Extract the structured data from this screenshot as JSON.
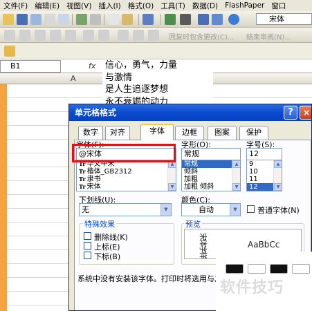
{
  "menubar": {
    "items": [
      "文件(F)",
      "编辑(E)",
      "视图(V)",
      "插入(I)",
      "格式(O)",
      "工具(T)",
      "数据(D)",
      "FlashPaper",
      "窗口"
    ]
  },
  "toolbar": {
    "font_name": "宋体",
    "review_reply": "回复时包含更改(C)...",
    "end_review": "结束审阅(N)..."
  },
  "formula_bar": {
    "name_box": "B1",
    "fx_label": "fx"
  },
  "sheet": {
    "column_a": "A",
    "cell_lines": [
      "信心，勇气，力量",
      "与激情",
      "是人生追逐梦想",
      "永不衰竭的动力"
    ]
  },
  "dialog": {
    "title": "单元格格式",
    "help": "?",
    "close": "×",
    "tabs": [
      "数字",
      "对齐",
      "字体",
      "边框",
      "图案",
      "保护"
    ],
    "active_tab": "字体",
    "font": {
      "label": "字体(F):",
      "value": "@宋体",
      "list": [
        "华文中宋",
        "楷体_GB2312",
        "隶书",
        "宋体"
      ]
    },
    "style": {
      "label": "字形(O):",
      "value": "常规",
      "list": [
        "常规",
        "倾斜",
        "加粗",
        "加粗 倾斜"
      ],
      "selected": "常规"
    },
    "size": {
      "label": "字号(S):",
      "value": "12",
      "list": [
        "9",
        "10",
        "11",
        "12"
      ],
      "selected": "12"
    },
    "underline": {
      "label": "下划线(U):",
      "value": "无"
    },
    "color": {
      "label": "颜色(C):",
      "value": "自动"
    },
    "normal_font": {
      "label": "普通字体(N)"
    },
    "effects": {
      "title": "特殊效果",
      "items": [
        "删除线(K)",
        "上标(E)",
        "下标(B)"
      ]
    },
    "preview": {
      "title": "预览",
      "sample": "AaBbCc",
      "rotated_sample": "宋体字样"
    },
    "status": "系统中没有安装该字体。打印时将选用与其"
  },
  "watermark": "软件技巧",
  "colors": {
    "title_bar": "#0a4bd3",
    "highlight": "#d9141b",
    "row_header": "#f5a33f",
    "selection": "#316ac5"
  }
}
